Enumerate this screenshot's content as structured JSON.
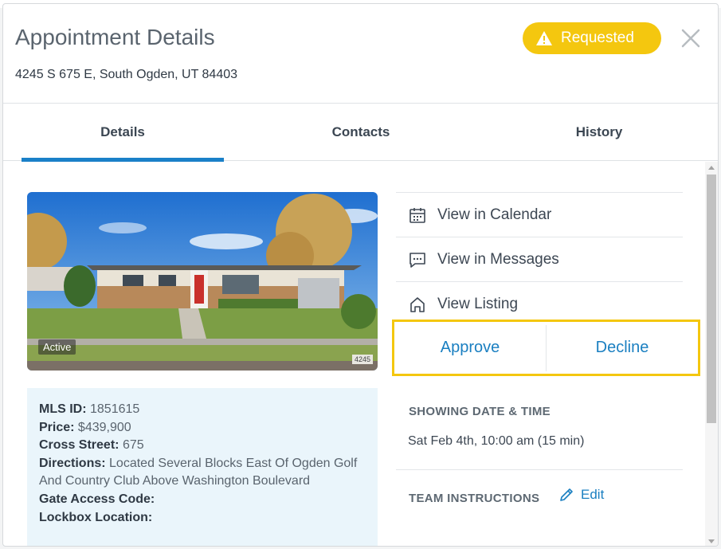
{
  "modal": {
    "title": "Appointment Details",
    "address": "4245 S 675 E, South Ogden, UT 84403",
    "status_badge": "Requested",
    "colors": {
      "badge": "#f4c70f",
      "accent": "#1a80c8",
      "link": "#1a7fc1",
      "info_bg": "#eaf5fb"
    }
  },
  "tabs": [
    {
      "label": "Details",
      "active": true
    },
    {
      "label": "Contacts",
      "active": false
    },
    {
      "label": "History",
      "active": false
    }
  ],
  "listing": {
    "status": "Active",
    "house_number": "4245",
    "fields": [
      {
        "label": "MLS ID:",
        "value": "1851615"
      },
      {
        "label": "Price:",
        "value": "$439,900"
      },
      {
        "label": "Cross Street:",
        "value": "675"
      },
      {
        "label": "Directions:",
        "value": "Located Several Blocks East Of Ogden Golf And Country Club Above Washington Boulevard"
      },
      {
        "label": "Gate Access Code:",
        "value": ""
      },
      {
        "label": "Lockbox Location:",
        "value": ""
      }
    ]
  },
  "actions": [
    {
      "label": "View in Calendar",
      "icon": "calendar-icon"
    },
    {
      "label": "View in Messages",
      "icon": "message-icon"
    },
    {
      "label": "View Listing",
      "icon": "home-icon"
    }
  ],
  "decision": {
    "approve": "Approve",
    "decline": "Decline"
  },
  "showing": {
    "heading": "SHOWING DATE & TIME",
    "value": "Sat Feb 4th, 10:00 am (15 min)"
  },
  "team_instructions": {
    "heading": "TEAM INSTRUCTIONS",
    "edit_label": "Edit"
  }
}
